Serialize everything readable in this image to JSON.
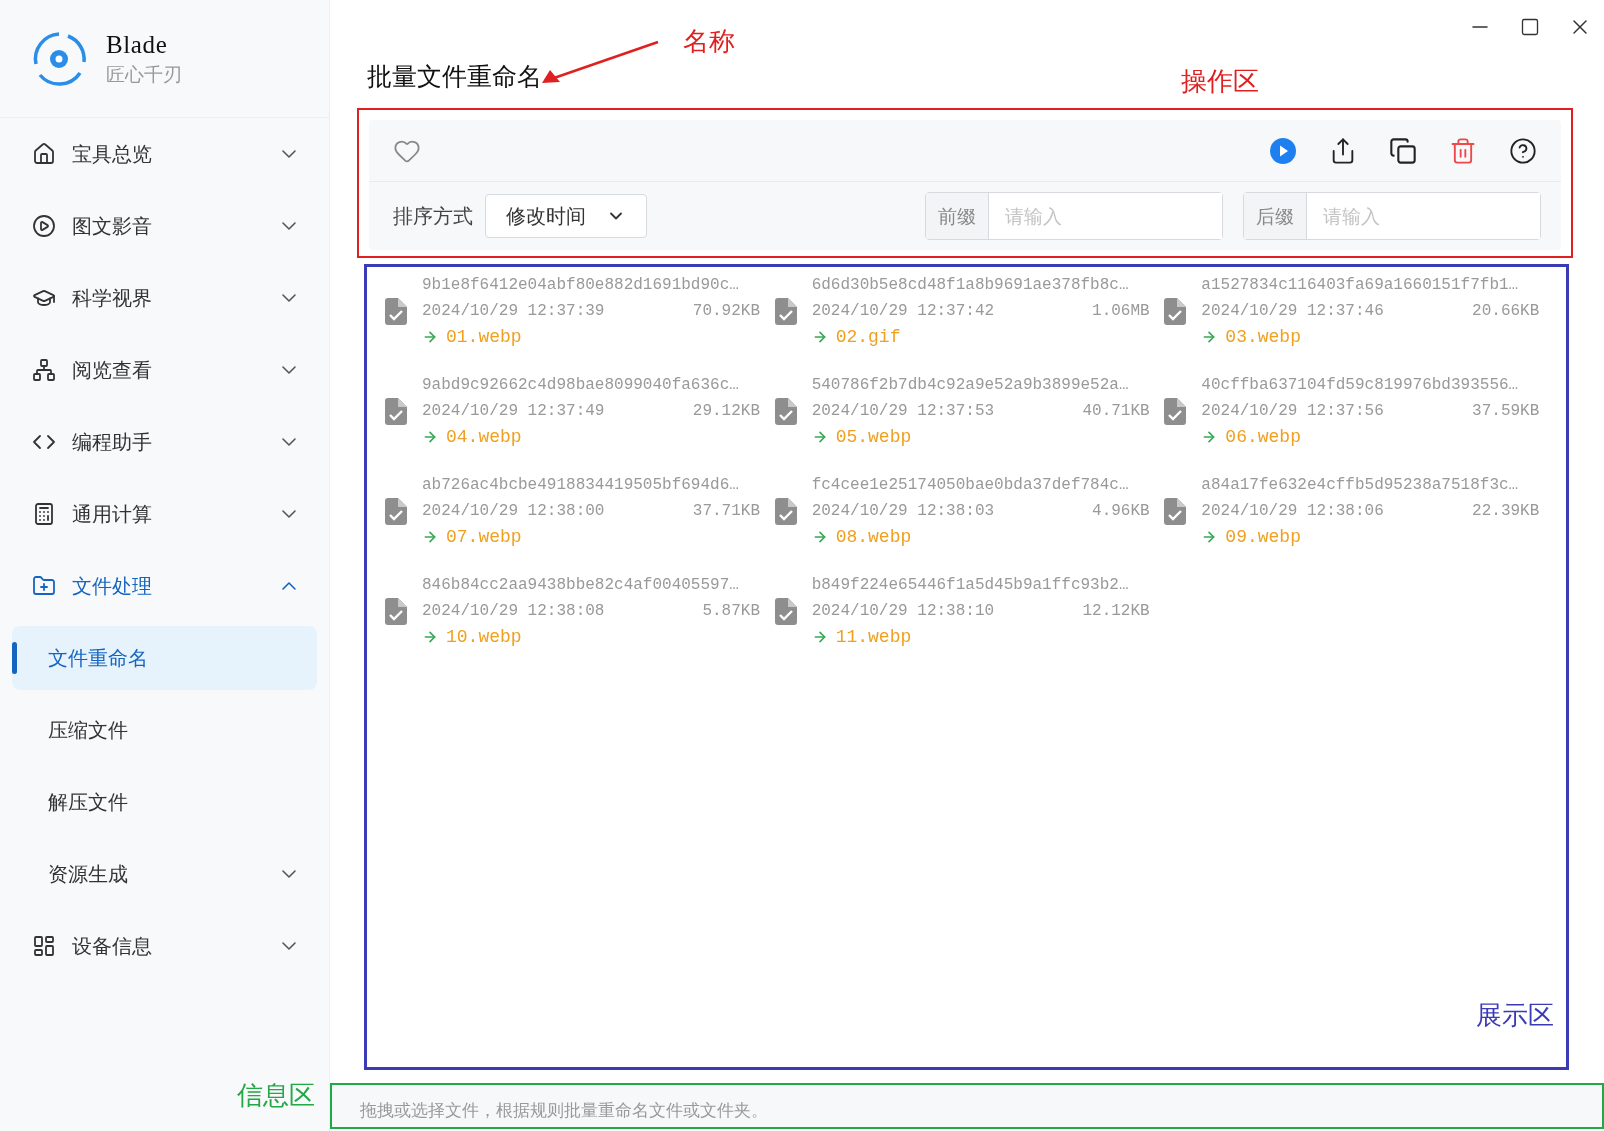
{
  "app": {
    "name": "Blade",
    "slogan": "匠心千刃"
  },
  "sidebar": {
    "items": [
      {
        "label": "宝具总览",
        "selected": false,
        "expanded": false
      },
      {
        "label": "图文影音",
        "selected": false,
        "expanded": false
      },
      {
        "label": "科学视界",
        "selected": false,
        "expanded": false
      },
      {
        "label": "阅览查看",
        "selected": false,
        "expanded": false
      },
      {
        "label": "编程助手",
        "selected": false,
        "expanded": false
      },
      {
        "label": "通用计算",
        "selected": false,
        "expanded": false
      },
      {
        "label": "文件处理",
        "selected": true,
        "expanded": true,
        "children": [
          {
            "label": "文件重命名",
            "kind": "leaf",
            "selected": true
          },
          {
            "label": "压缩文件",
            "kind": "leaf",
            "selected": false
          },
          {
            "label": "解压文件",
            "kind": "leaf",
            "selected": false
          },
          {
            "label": "资源生成",
            "kind": "group",
            "selected": false,
            "expanded": false
          }
        ]
      },
      {
        "label": "设备信息",
        "selected": false,
        "expanded": false
      }
    ]
  },
  "page": {
    "title": "批量文件重命名"
  },
  "toolbar": {
    "sort_label": "排序方式",
    "sort_value": "修改时间",
    "prefix": {
      "label": "前缀",
      "placeholder": "请输入"
    },
    "suffix": {
      "label": "后缀",
      "placeholder": "请输入"
    }
  },
  "files": [
    {
      "name": "9b1e8f6412e04abf80e882d1691bd90c…",
      "time": "2024/10/29 12:37:39",
      "size": "70.92KB",
      "new_name": "01.webp"
    },
    {
      "name": "6d6d30b5e8cd48f1a8b9691ae378fb8c…",
      "time": "2024/10/29 12:37:42",
      "size": "1.06MB",
      "new_name": "02.gif"
    },
    {
      "name": "a1527834c116403fa69a1660151f7fb1…",
      "time": "2024/10/29 12:37:46",
      "size": "20.66KB",
      "new_name": "03.webp"
    },
    {
      "name": "9abd9c92662c4d98bae8099040fa636c…",
      "time": "2024/10/29 12:37:49",
      "size": "29.12KB",
      "new_name": "04.webp"
    },
    {
      "name": "540786f2b7db4c92a9e52a9b3899e52a…",
      "time": "2024/10/29 12:37:53",
      "size": "40.71KB",
      "new_name": "05.webp"
    },
    {
      "name": "40cffba637104fd59c819976bd393556…",
      "time": "2024/10/29 12:37:56",
      "size": "37.59KB",
      "new_name": "06.webp"
    },
    {
      "name": "ab726ac4bcbe4918834419505bf694d6…",
      "time": "2024/10/29 12:38:00",
      "size": "37.71KB",
      "new_name": "07.webp"
    },
    {
      "name": "fc4cee1e25174050bae0bda37def784c…",
      "time": "2024/10/29 12:38:03",
      "size": "4.96KB",
      "new_name": "08.webp"
    },
    {
      "name": "a84a17fe632e4cffb5d95238a7518f3c…",
      "time": "2024/10/29 12:38:06",
      "size": "22.39KB",
      "new_name": "09.webp"
    },
    {
      "name": "846b84cc2aa9438bbe82c4af00405597…",
      "time": "2024/10/29 12:38:08",
      "size": "5.87KB",
      "new_name": "10.webp"
    },
    {
      "name": "b849f224e65446f1a5d45b9a1ffc93b2…",
      "time": "2024/10/29 12:38:10",
      "size": "12.12KB",
      "new_name": "11.webp"
    }
  ],
  "status_bar": {
    "text": "拖拽或选择文件，根据规则批量重命名文件或文件夹。"
  },
  "annotations": {
    "title_label": "名称",
    "operation_label": "操作区",
    "display_label": "展示区",
    "info_label": "信息区"
  }
}
